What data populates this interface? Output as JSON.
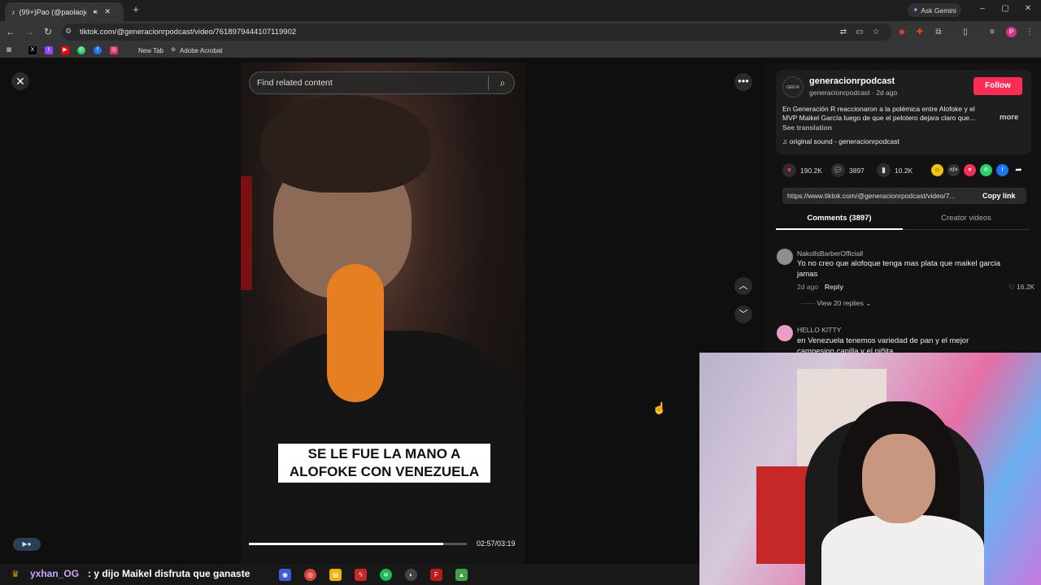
{
  "browser": {
    "tab_title": "(99+)Pao (@paolaojedda) |",
    "new_tab_symbol": "+",
    "ask_gemini": "Ask Gemini",
    "url": "tiktok.com/@generacionrpodcast/video/7618979444107119902",
    "profile_initial": "P",
    "bookmarks": [
      {
        "label": "New Tab"
      },
      {
        "label": "Adobe Acrobat"
      }
    ]
  },
  "video": {
    "search_placeholder": "Find related content",
    "caption_line1": "SE LE FUE LA MANO A",
    "caption_line2": "ALOFOKE CON VENEZUELA",
    "timecode": "02:57/03:19",
    "progress_fraction": 0.89
  },
  "post": {
    "username": "generacionrpodcast",
    "subline": "generacionrpodcast · 2d ago",
    "follow_label": "Follow",
    "description": "En Generación R reaccionaron a la polémica entre Alofoke y el MVP Maikel García luego de que el pelotero dejara claro que...",
    "more_label": "more",
    "see_translation": "See translation",
    "sound": "original sound - generacionrpodcast",
    "likes": "190.2K",
    "comments_count": "3897",
    "saves": "10.2K",
    "link": "https://www.tiktok.com/@generacionrpodcast/video/7...",
    "copy_link": "Copy link"
  },
  "tabs": {
    "comments": "Comments (3897)",
    "creator": "Creator videos"
  },
  "comments": [
    {
      "user": "NakollsBarberOfficiall",
      "text": "Yo no creo que alofoque tenga mas plata que maikel garcia jamas",
      "time": "2d ago",
      "reply": "Reply",
      "likes": "16.2K",
      "view_replies": "View 20 replies"
    },
    {
      "user": "HELLO KITTY",
      "text": "en Venezuela tenemos variedad de pan y el mejor campesino canilla y el piñita"
    }
  ],
  "chat": {
    "user": "yxhan_OG",
    "message": ": y dijo Maikel disfruta que ganaste"
  },
  "colors": {
    "follow": "#fe2c55",
    "page_bg": "#0f0f0f",
    "chat_user": "#c9a4ff"
  }
}
